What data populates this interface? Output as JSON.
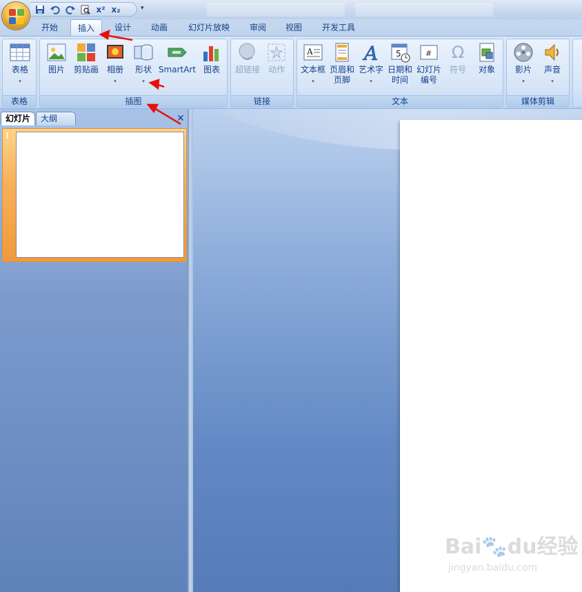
{
  "tabs": [
    "开始",
    "插入",
    "设计",
    "动画",
    "幻灯片放映",
    "审阅",
    "视图",
    "开发工具"
  ],
  "ribbon": {
    "groups": {
      "table": "表格",
      "illustrations": "插图",
      "links": "链接",
      "text": "文本",
      "media": "媒体剪辑"
    },
    "buttons": {
      "table": "表格",
      "picture": "图片",
      "clipart": "剪贴画",
      "album": "相册",
      "shapes": "形状",
      "smartart": "SmartArt",
      "chart": "图表",
      "hyperlink": "超链接",
      "action": "动作",
      "textbox": "文本框",
      "header_footer_1": "页眉和",
      "header_footer_2": "页脚",
      "wordart": "艺术字",
      "datetime_1": "日期和",
      "datetime_2": "时间",
      "slidenum_1": "幻灯片",
      "slidenum_2": "编号",
      "symbol": "符号",
      "object": "对象",
      "movie": "影片",
      "sound": "声音"
    }
  },
  "pane": {
    "tab_slides": "幻灯片",
    "tab_outline": "大纲",
    "thumb_number": "1"
  },
  "watermark": {
    "main": "Bai🐾du经验",
    "sub": "jingyan.baidu.com"
  },
  "colors": {
    "accent": "#15428b",
    "annotation": "#e8100c",
    "selection": "#f29a3a"
  }
}
